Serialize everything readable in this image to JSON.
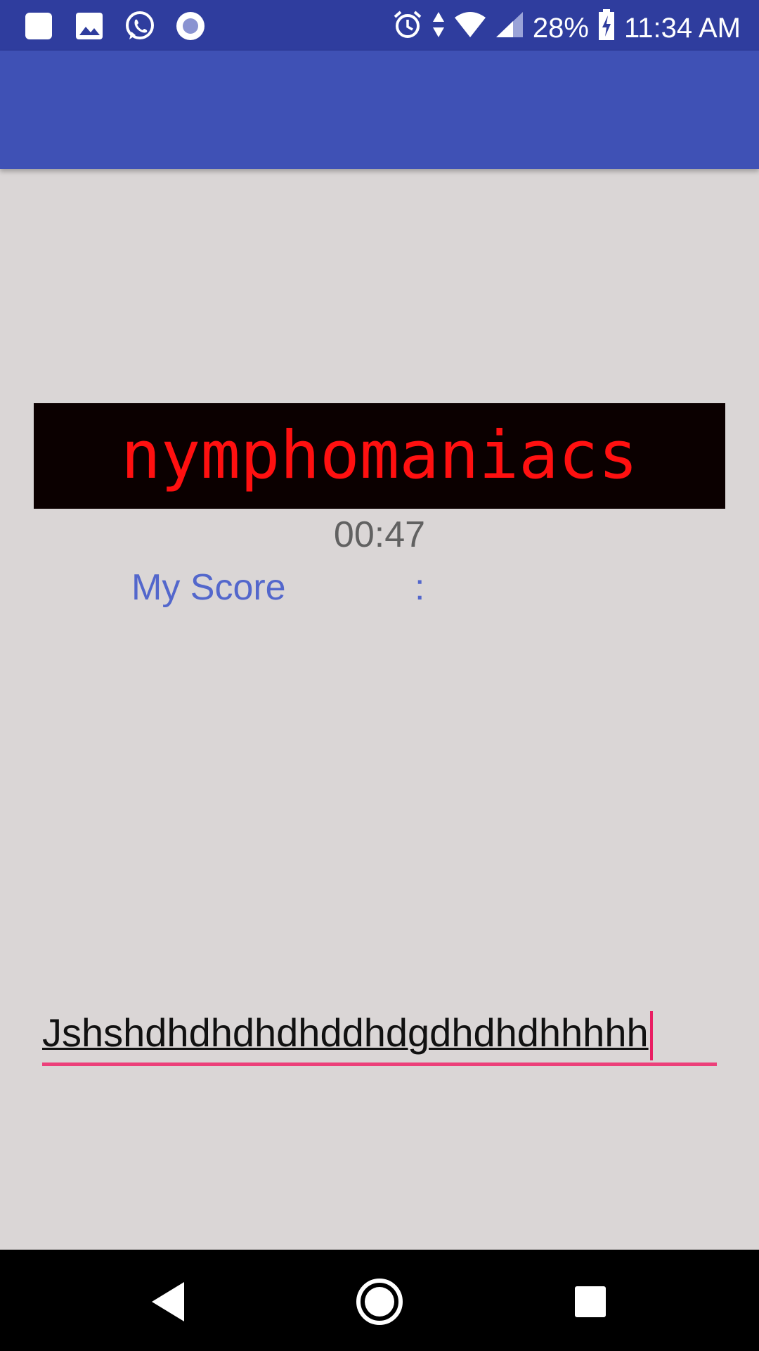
{
  "status_bar": {
    "left_icons": [
      "notification-square-icon",
      "gallery-icon",
      "whatsapp-icon",
      "record-icon"
    ],
    "right_icons": [
      "alarm-icon",
      "data-arrows-icon",
      "wifi-icon",
      "signal-icon"
    ],
    "battery_percent": "28%",
    "battery_icon": "battery-charging-icon",
    "time": "11:34 AM",
    "background_color": "#2f3d9e"
  },
  "app_bar": {
    "background_color": "#3f51b5"
  },
  "game": {
    "word": "nymphomaniacs",
    "word_color": "#ff1010",
    "word_box_color": "#0b0000",
    "timer": "00:47",
    "score_label": "My Score",
    "score_separator": ":",
    "score_color": "#5367cc"
  },
  "input": {
    "value": "Jshshdhdhdhdhddhdgdhdhdhhhhh",
    "accent_color": "#ec407a"
  },
  "nav_bar": {
    "buttons": [
      "back-icon",
      "home-icon",
      "recents-icon"
    ]
  }
}
